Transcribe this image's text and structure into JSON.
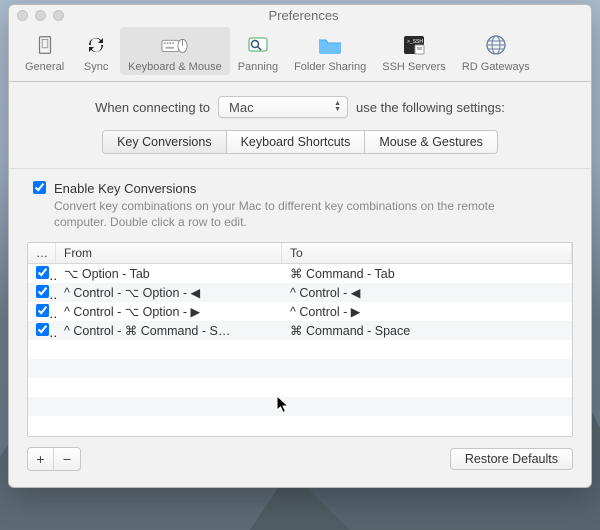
{
  "window": {
    "title": "Preferences"
  },
  "toolbar": {
    "items": [
      {
        "label": "General"
      },
      {
        "label": "Sync"
      },
      {
        "label": "Keyboard & Mouse"
      },
      {
        "label": "Panning"
      },
      {
        "label": "Folder Sharing"
      },
      {
        "label": "SSH Servers"
      },
      {
        "label": "RD Gateways"
      }
    ],
    "selected_index": 2
  },
  "connecting": {
    "prefix": "When connecting to",
    "value": "Mac",
    "suffix": "use the following settings:"
  },
  "segments": {
    "items": [
      "Key Conversions",
      "Keyboard Shortcuts",
      "Mouse & Gestures"
    ],
    "active_index": 0
  },
  "enable": {
    "checked": true,
    "label": "Enable Key Conversions",
    "help": "Convert key combinations on your Mac to different key combinations on the remote computer. Double click a row to edit."
  },
  "table": {
    "headers": {
      "enabled": "…",
      "from": "From",
      "to": "To"
    },
    "rows": [
      {
        "enabled": true,
        "from": "⌥ Option - Tab",
        "to": "⌘ Command - Tab"
      },
      {
        "enabled": true,
        "from": "^ Control - ⌥ Option - ◀",
        "to": "^ Control - ◀"
      },
      {
        "enabled": true,
        "from": "^ Control - ⌥ Option - ▶",
        "to": "^ Control - ▶"
      },
      {
        "enabled": true,
        "from": "^ Control - ⌘ Command - S…",
        "to": "⌘ Command - Space"
      }
    ]
  },
  "footer": {
    "add": "+",
    "remove": "−",
    "restore": "Restore Defaults"
  }
}
